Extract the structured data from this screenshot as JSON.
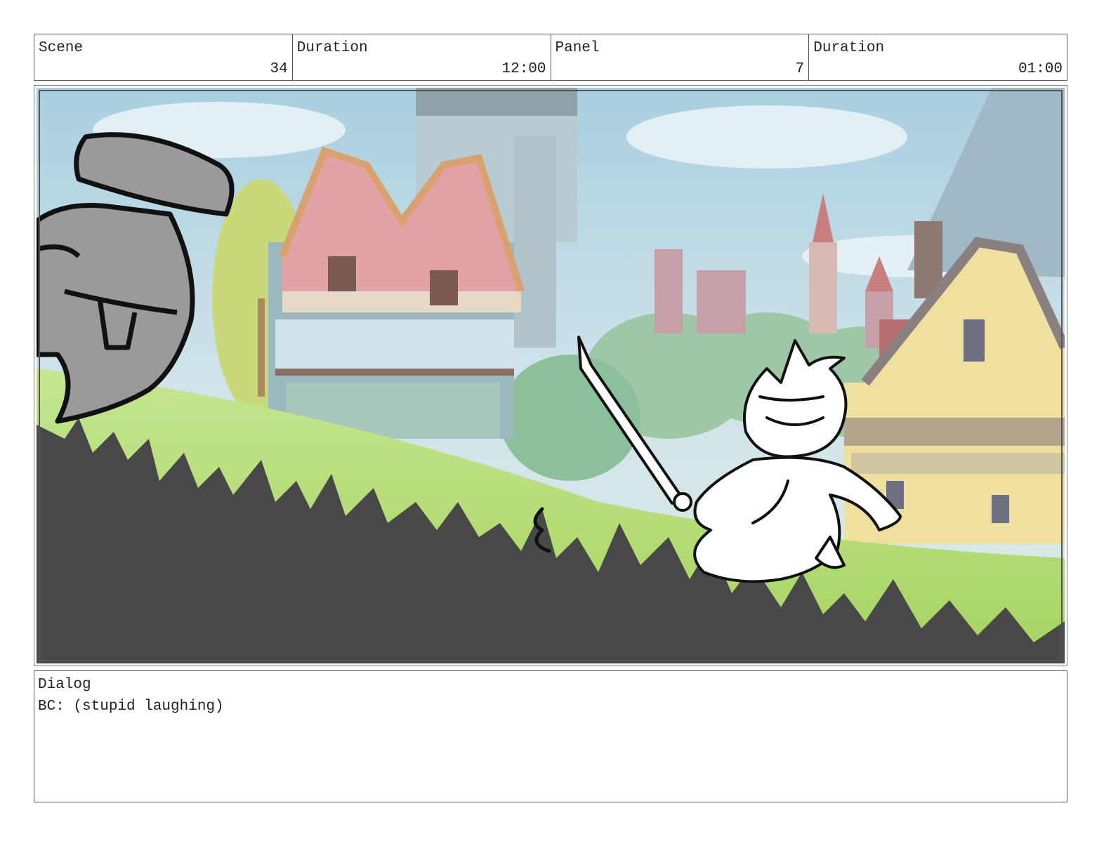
{
  "header": {
    "scene_label": "Scene",
    "scene_value": "34",
    "scene_duration_label": "Duration",
    "scene_duration_value": "12:00",
    "panel_label": "Panel",
    "panel_value": "7",
    "panel_duration_label": "Duration",
    "panel_duration_value": "01:00"
  },
  "panel_image": {
    "colors": {
      "sky": "#bcd9e6",
      "grass": "#b9e07a",
      "foreground_grass": "#484848",
      "knight_gray": "#9a9a9a",
      "building_pink": "#e3a3a6",
      "building_yellow": "#efe0a0"
    }
  },
  "dialog": {
    "label": "Dialog",
    "text": "BC: (stupid laughing)"
  }
}
